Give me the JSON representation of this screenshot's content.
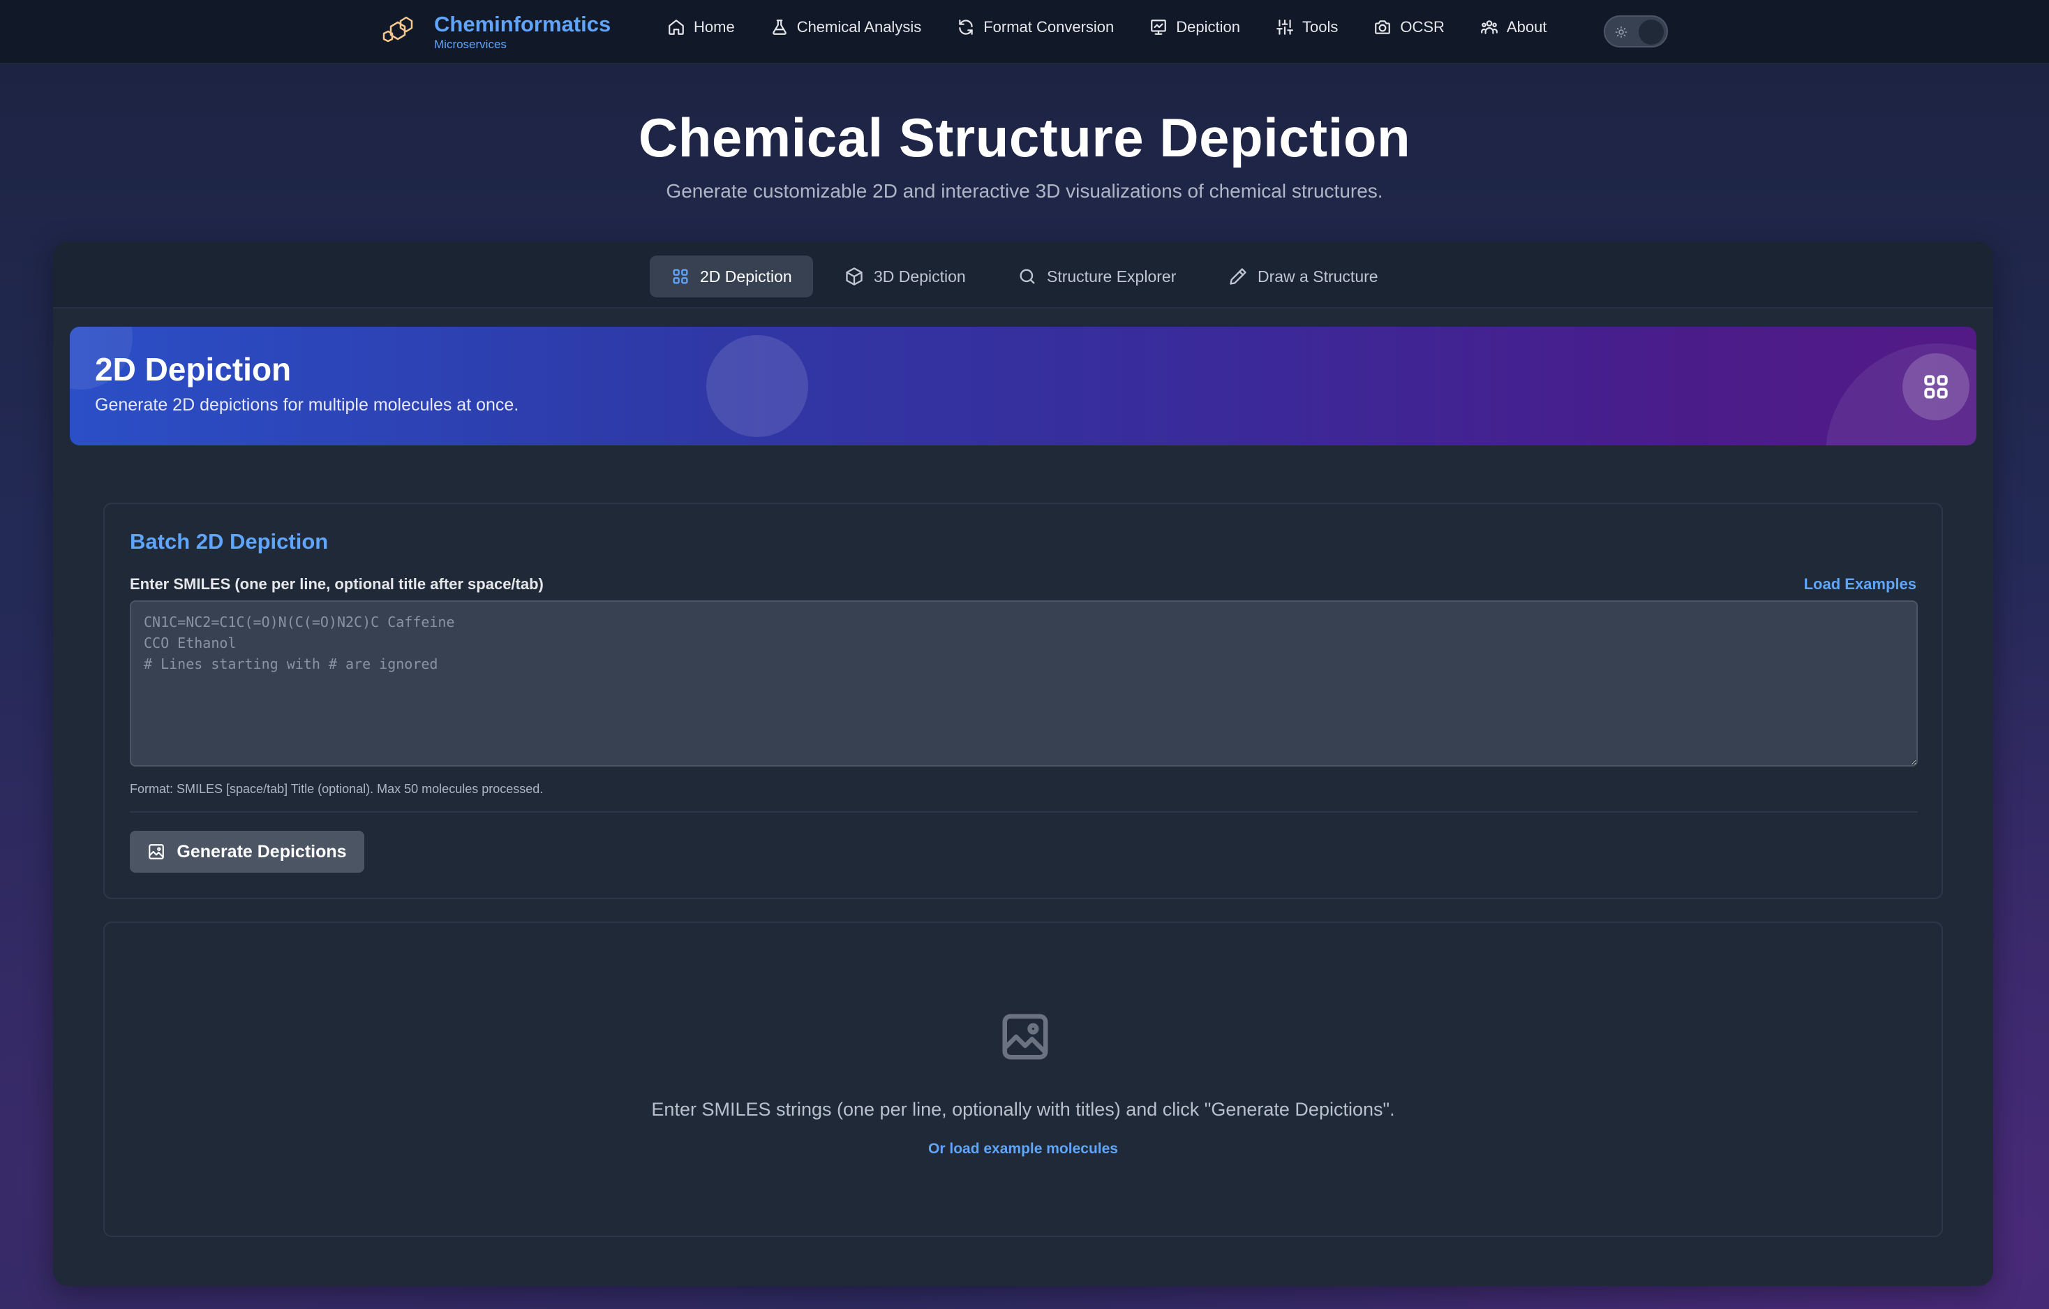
{
  "colors": {
    "accent": "#60a5fa",
    "nav_bg": "#111827",
    "card_bg": "#1f2937",
    "active_tab_bg": "#374151",
    "banner_start": "#2b4fc7",
    "banner_end": "#531a86",
    "button_bg": "#4b5563"
  },
  "brand": {
    "name": "Cheminformatics",
    "subtitle": "Microservices",
    "icon": "hexagon-molecule-icon"
  },
  "nav": {
    "items": [
      {
        "label": "Home",
        "icon": "home-icon"
      },
      {
        "label": "Chemical Analysis",
        "icon": "flask-icon"
      },
      {
        "label": "Format Conversion",
        "icon": "refresh-icon"
      },
      {
        "label": "Depiction",
        "icon": "chart-icon"
      },
      {
        "label": "Tools",
        "icon": "sliders-icon"
      },
      {
        "label": "OCSR",
        "icon": "camera-icon"
      },
      {
        "label": "About",
        "icon": "users-icon"
      }
    ],
    "theme_toggle": {
      "icon": "sun-icon",
      "state": "dark"
    }
  },
  "header": {
    "title": "Chemical Structure Depiction",
    "subtitle": "Generate customizable 2D and interactive 3D visualizations of chemical structures."
  },
  "tabs": [
    {
      "label": "2D Depiction",
      "icon": "grid-icon",
      "active": true
    },
    {
      "label": "3D Depiction",
      "icon": "cube-icon",
      "active": false
    },
    {
      "label": "Structure Explorer",
      "icon": "search-icon",
      "active": false
    },
    {
      "label": "Draw a Structure",
      "icon": "pencil-icon",
      "active": false
    }
  ],
  "banner": {
    "title": "2D Depiction",
    "subtitle": "Generate 2D depictions for multiple molecules at once.",
    "icon": "grid-icon"
  },
  "form": {
    "title": "Batch 2D Depiction",
    "label": "Enter SMILES (one per line, optional title after space/tab)",
    "load_examples": "Load Examples",
    "input_value": "",
    "input_placeholder": "CN1C=NC2=C1C(=O)N(C(=O)N2C)C Caffeine\nCCO Ethanol\n# Lines starting with # are ignored",
    "hint": "Format: SMILES [space/tab] Title (optional). Max 50 molecules processed.",
    "generate_label": "Generate Depictions",
    "generate_icon": "image-icon"
  },
  "results": {
    "empty_icon": "image-icon",
    "empty_text": "Enter SMILES strings (one per line, optionally with titles) and click \"Generate Depictions\".",
    "load_link": "Or load example molecules"
  }
}
